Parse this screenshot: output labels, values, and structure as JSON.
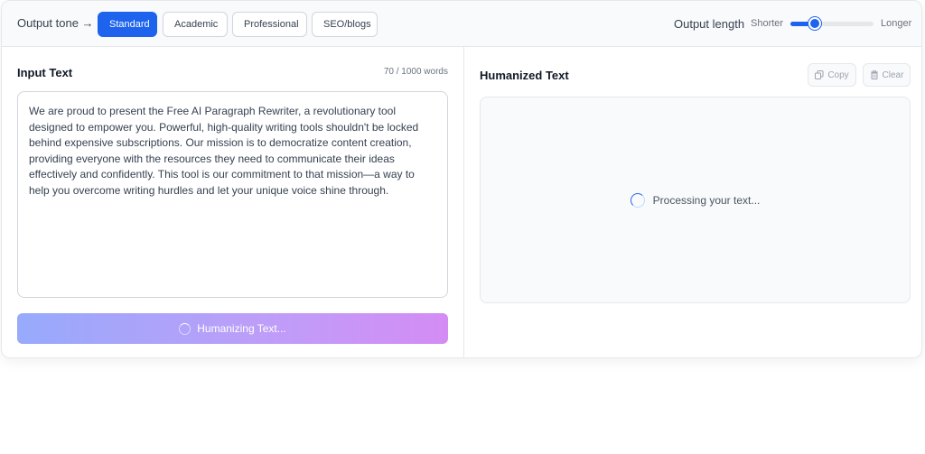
{
  "toolbar": {
    "tone_label": "Output tone →",
    "tones": [
      {
        "label": "Standard",
        "active": true
      },
      {
        "label": "Academic",
        "active": false
      },
      {
        "label": "Professional",
        "active": false
      },
      {
        "label": "SEO/blogs",
        "active": false
      }
    ],
    "length_label": "Output length",
    "shorter_label": "Shorter",
    "longer_label": "Longer",
    "length_value": 0.25
  },
  "input": {
    "title": "Input Text",
    "word_count": "70 / 1000 words",
    "text": "We are proud to present the Free AI Paragraph Rewriter, a revolutionary tool designed to empower you. Powerful, high-quality writing tools shouldn't be locked behind expensive subscriptions. Our mission is to democratize content creation, providing everyone with the resources they need to communicate their ideas effectively and confidently. This tool is our commitment to that mission—a way to help you overcome writing hurdles and let your unique voice shine through.",
    "button_label": "Humanizing Text..."
  },
  "output": {
    "title": "Humanized Text",
    "copy_label": "Copy",
    "clear_label": "Clear",
    "status": "Processing your text..."
  },
  "colors": {
    "accent": "#1d63ed",
    "gradient_start": "#97aafc",
    "gradient_end": "#d48cf4"
  },
  "icons": {
    "copy": "copy-icon",
    "clear": "trash-icon",
    "spinner": "spinner-icon"
  }
}
